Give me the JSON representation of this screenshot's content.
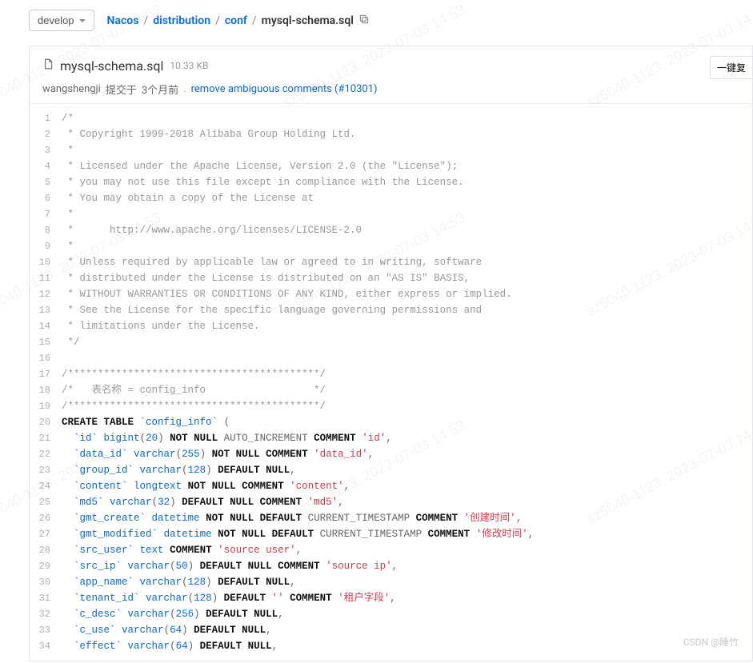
{
  "branch": {
    "label": "develop"
  },
  "breadcrumb": {
    "parts": [
      "Nacos",
      "distribution",
      "conf"
    ],
    "current": "mysql-schema.sql"
  },
  "file": {
    "name": "mysql-schema.sql",
    "size": "10.33 KB"
  },
  "commit": {
    "author": "wangshengji",
    "rel_time_prefix": "提交于",
    "rel_time": "3个月前",
    "message": "remove ambiguous comments (#10301)"
  },
  "actions": {
    "copy": "一键复"
  },
  "watermarks": {
    "corner": "CSDN @睡竹",
    "diag": "sz5040-1123, 2023-07-03 14:53"
  },
  "code": {
    "lines": [
      {
        "n": 1,
        "t": "comment",
        "text": "/*"
      },
      {
        "n": 2,
        "t": "comment",
        "text": " * Copyright 1999-2018 Alibaba Group Holding Ltd."
      },
      {
        "n": 3,
        "t": "comment",
        "text": " *"
      },
      {
        "n": 4,
        "t": "comment",
        "text": " * Licensed under the Apache License, Version 2.0 (the \"License\");"
      },
      {
        "n": 5,
        "t": "comment",
        "text": " * you may not use this file except in compliance with the License."
      },
      {
        "n": 6,
        "t": "comment",
        "text": " * You may obtain a copy of the License at"
      },
      {
        "n": 7,
        "t": "comment",
        "text": " *"
      },
      {
        "n": 8,
        "t": "comment",
        "text": " *      http://www.apache.org/licenses/LICENSE-2.0"
      },
      {
        "n": 9,
        "t": "comment",
        "text": " *"
      },
      {
        "n": 10,
        "t": "comment",
        "text": " * Unless required by applicable law or agreed to in writing, software"
      },
      {
        "n": 11,
        "t": "comment",
        "text": " * distributed under the License is distributed on an \"AS IS\" BASIS,"
      },
      {
        "n": 12,
        "t": "comment",
        "text": " * WITHOUT WARRANTIES OR CONDITIONS OF ANY KIND, either express or implied."
      },
      {
        "n": 13,
        "t": "comment",
        "text": " * See the License for the specific language governing permissions and"
      },
      {
        "n": 14,
        "t": "comment",
        "text": " * limitations under the License."
      },
      {
        "n": 15,
        "t": "comment",
        "text": " */"
      },
      {
        "n": 16,
        "t": "blank",
        "text": ""
      },
      {
        "n": 17,
        "t": "comment",
        "text": "/******************************************/"
      },
      {
        "n": 18,
        "t": "comment",
        "text": "/*   表名称 = config_info                  */"
      },
      {
        "n": 19,
        "t": "comment",
        "text": "/******************************************/"
      },
      {
        "n": 20,
        "t": "sql",
        "tokens": [
          {
            "c": "kw",
            "v": "CREATE TABLE"
          },
          {
            "c": "p",
            "v": " "
          },
          {
            "c": "name",
            "v": "`config_info`"
          },
          {
            "c": "p",
            "v": " ("
          }
        ]
      },
      {
        "n": 21,
        "t": "sql",
        "tokens": [
          {
            "c": "p",
            "v": "  "
          },
          {
            "c": "name",
            "v": "`id`"
          },
          {
            "c": "p",
            "v": " "
          },
          {
            "c": "name",
            "v": "bigint"
          },
          {
            "c": "p",
            "v": "("
          },
          {
            "c": "num",
            "v": "20"
          },
          {
            "c": "p",
            "v": ") "
          },
          {
            "c": "kw",
            "v": "NOT NULL"
          },
          {
            "c": "p",
            "v": " AUTO_INCREMENT "
          },
          {
            "c": "kw",
            "v": "COMMENT"
          },
          {
            "c": "p",
            "v": " "
          },
          {
            "c": "str",
            "v": "'id'"
          },
          {
            "c": "p",
            "v": ","
          }
        ]
      },
      {
        "n": 22,
        "t": "sql",
        "tokens": [
          {
            "c": "p",
            "v": "  "
          },
          {
            "c": "name",
            "v": "`data_id`"
          },
          {
            "c": "p",
            "v": " "
          },
          {
            "c": "name",
            "v": "varchar"
          },
          {
            "c": "p",
            "v": "("
          },
          {
            "c": "num",
            "v": "255"
          },
          {
            "c": "p",
            "v": ") "
          },
          {
            "c": "kw",
            "v": "NOT NULL COMMENT"
          },
          {
            "c": "p",
            "v": " "
          },
          {
            "c": "str",
            "v": "'data_id'"
          },
          {
            "c": "p",
            "v": ","
          }
        ]
      },
      {
        "n": 23,
        "t": "sql",
        "tokens": [
          {
            "c": "p",
            "v": "  "
          },
          {
            "c": "name",
            "v": "`group_id`"
          },
          {
            "c": "p",
            "v": " "
          },
          {
            "c": "name",
            "v": "varchar"
          },
          {
            "c": "p",
            "v": "("
          },
          {
            "c": "num",
            "v": "128"
          },
          {
            "c": "p",
            "v": ") "
          },
          {
            "c": "kw",
            "v": "DEFAULT NULL"
          },
          {
            "c": "p",
            "v": ","
          }
        ]
      },
      {
        "n": 24,
        "t": "sql",
        "tokens": [
          {
            "c": "p",
            "v": "  "
          },
          {
            "c": "name",
            "v": "`content`"
          },
          {
            "c": "p",
            "v": " "
          },
          {
            "c": "name",
            "v": "longtext"
          },
          {
            "c": "p",
            "v": " "
          },
          {
            "c": "kw",
            "v": "NOT NULL COMMENT"
          },
          {
            "c": "p",
            "v": " "
          },
          {
            "c": "str",
            "v": "'content'"
          },
          {
            "c": "p",
            "v": ","
          }
        ]
      },
      {
        "n": 25,
        "t": "sql",
        "tokens": [
          {
            "c": "p",
            "v": "  "
          },
          {
            "c": "name",
            "v": "`md5`"
          },
          {
            "c": "p",
            "v": " "
          },
          {
            "c": "name",
            "v": "varchar"
          },
          {
            "c": "p",
            "v": "("
          },
          {
            "c": "num",
            "v": "32"
          },
          {
            "c": "p",
            "v": ") "
          },
          {
            "c": "kw",
            "v": "DEFAULT NULL COMMENT"
          },
          {
            "c": "p",
            "v": " "
          },
          {
            "c": "str",
            "v": "'md5'"
          },
          {
            "c": "p",
            "v": ","
          }
        ]
      },
      {
        "n": 26,
        "t": "sql",
        "tokens": [
          {
            "c": "p",
            "v": "  "
          },
          {
            "c": "name",
            "v": "`gmt_create`"
          },
          {
            "c": "p",
            "v": " "
          },
          {
            "c": "name",
            "v": "datetime"
          },
          {
            "c": "p",
            "v": " "
          },
          {
            "c": "kw",
            "v": "NOT NULL DEFAULT"
          },
          {
            "c": "p",
            "v": " CURRENT_TIMESTAMP "
          },
          {
            "c": "kw",
            "v": "COMMENT"
          },
          {
            "c": "p",
            "v": " "
          },
          {
            "c": "str",
            "v": "'创建时间'"
          },
          {
            "c": "p",
            "v": ","
          }
        ]
      },
      {
        "n": 27,
        "t": "sql",
        "tokens": [
          {
            "c": "p",
            "v": "  "
          },
          {
            "c": "name",
            "v": "`gmt_modified`"
          },
          {
            "c": "p",
            "v": " "
          },
          {
            "c": "name",
            "v": "datetime"
          },
          {
            "c": "p",
            "v": " "
          },
          {
            "c": "kw",
            "v": "NOT NULL DEFAULT"
          },
          {
            "c": "p",
            "v": " CURRENT_TIMESTAMP "
          },
          {
            "c": "kw",
            "v": "COMMENT"
          },
          {
            "c": "p",
            "v": " "
          },
          {
            "c": "str",
            "v": "'修改时间'"
          },
          {
            "c": "p",
            "v": ","
          }
        ]
      },
      {
        "n": 28,
        "t": "sql",
        "tokens": [
          {
            "c": "p",
            "v": "  "
          },
          {
            "c": "name",
            "v": "`src_user`"
          },
          {
            "c": "p",
            "v": " "
          },
          {
            "c": "name",
            "v": "text"
          },
          {
            "c": "p",
            "v": " "
          },
          {
            "c": "kw",
            "v": "COMMENT"
          },
          {
            "c": "p",
            "v": " "
          },
          {
            "c": "str",
            "v": "'source user'"
          },
          {
            "c": "p",
            "v": ","
          }
        ]
      },
      {
        "n": 29,
        "t": "sql",
        "tokens": [
          {
            "c": "p",
            "v": "  "
          },
          {
            "c": "name",
            "v": "`src_ip`"
          },
          {
            "c": "p",
            "v": " "
          },
          {
            "c": "name",
            "v": "varchar"
          },
          {
            "c": "p",
            "v": "("
          },
          {
            "c": "num",
            "v": "50"
          },
          {
            "c": "p",
            "v": ") "
          },
          {
            "c": "kw",
            "v": "DEFAULT NULL COMMENT"
          },
          {
            "c": "p",
            "v": " "
          },
          {
            "c": "str",
            "v": "'source ip'"
          },
          {
            "c": "p",
            "v": ","
          }
        ]
      },
      {
        "n": 30,
        "t": "sql",
        "tokens": [
          {
            "c": "p",
            "v": "  "
          },
          {
            "c": "name",
            "v": "`app_name`"
          },
          {
            "c": "p",
            "v": " "
          },
          {
            "c": "name",
            "v": "varchar"
          },
          {
            "c": "p",
            "v": "("
          },
          {
            "c": "num",
            "v": "128"
          },
          {
            "c": "p",
            "v": ") "
          },
          {
            "c": "kw",
            "v": "DEFAULT NULL"
          },
          {
            "c": "p",
            "v": ","
          }
        ]
      },
      {
        "n": 31,
        "t": "sql",
        "tokens": [
          {
            "c": "p",
            "v": "  "
          },
          {
            "c": "name",
            "v": "`tenant_id`"
          },
          {
            "c": "p",
            "v": " "
          },
          {
            "c": "name",
            "v": "varchar"
          },
          {
            "c": "p",
            "v": "("
          },
          {
            "c": "num",
            "v": "128"
          },
          {
            "c": "p",
            "v": ") "
          },
          {
            "c": "kw",
            "v": "DEFAULT"
          },
          {
            "c": "p",
            "v": " "
          },
          {
            "c": "str",
            "v": "''"
          },
          {
            "c": "p",
            "v": " "
          },
          {
            "c": "kw",
            "v": "COMMENT"
          },
          {
            "c": "p",
            "v": " "
          },
          {
            "c": "str",
            "v": "'租户字段'"
          },
          {
            "c": "p",
            "v": ","
          }
        ]
      },
      {
        "n": 32,
        "t": "sql",
        "tokens": [
          {
            "c": "p",
            "v": "  "
          },
          {
            "c": "name",
            "v": "`c_desc`"
          },
          {
            "c": "p",
            "v": " "
          },
          {
            "c": "name",
            "v": "varchar"
          },
          {
            "c": "p",
            "v": "("
          },
          {
            "c": "num",
            "v": "256"
          },
          {
            "c": "p",
            "v": ") "
          },
          {
            "c": "kw",
            "v": "DEFAULT NULL"
          },
          {
            "c": "p",
            "v": ","
          }
        ]
      },
      {
        "n": 33,
        "t": "sql",
        "tokens": [
          {
            "c": "p",
            "v": "  "
          },
          {
            "c": "name",
            "v": "`c_use`"
          },
          {
            "c": "p",
            "v": " "
          },
          {
            "c": "name",
            "v": "varchar"
          },
          {
            "c": "p",
            "v": "("
          },
          {
            "c": "num",
            "v": "64"
          },
          {
            "c": "p",
            "v": ") "
          },
          {
            "c": "kw",
            "v": "DEFAULT NULL"
          },
          {
            "c": "p",
            "v": ","
          }
        ]
      },
      {
        "n": 34,
        "t": "sql",
        "tokens": [
          {
            "c": "p",
            "v": "  "
          },
          {
            "c": "name",
            "v": "`effect`"
          },
          {
            "c": "p",
            "v": " "
          },
          {
            "c": "name",
            "v": "varchar"
          },
          {
            "c": "p",
            "v": "("
          },
          {
            "c": "num",
            "v": "64"
          },
          {
            "c": "p",
            "v": ") "
          },
          {
            "c": "kw",
            "v": "DEFAULT NULL"
          },
          {
            "c": "p",
            "v": ","
          }
        ]
      }
    ]
  }
}
